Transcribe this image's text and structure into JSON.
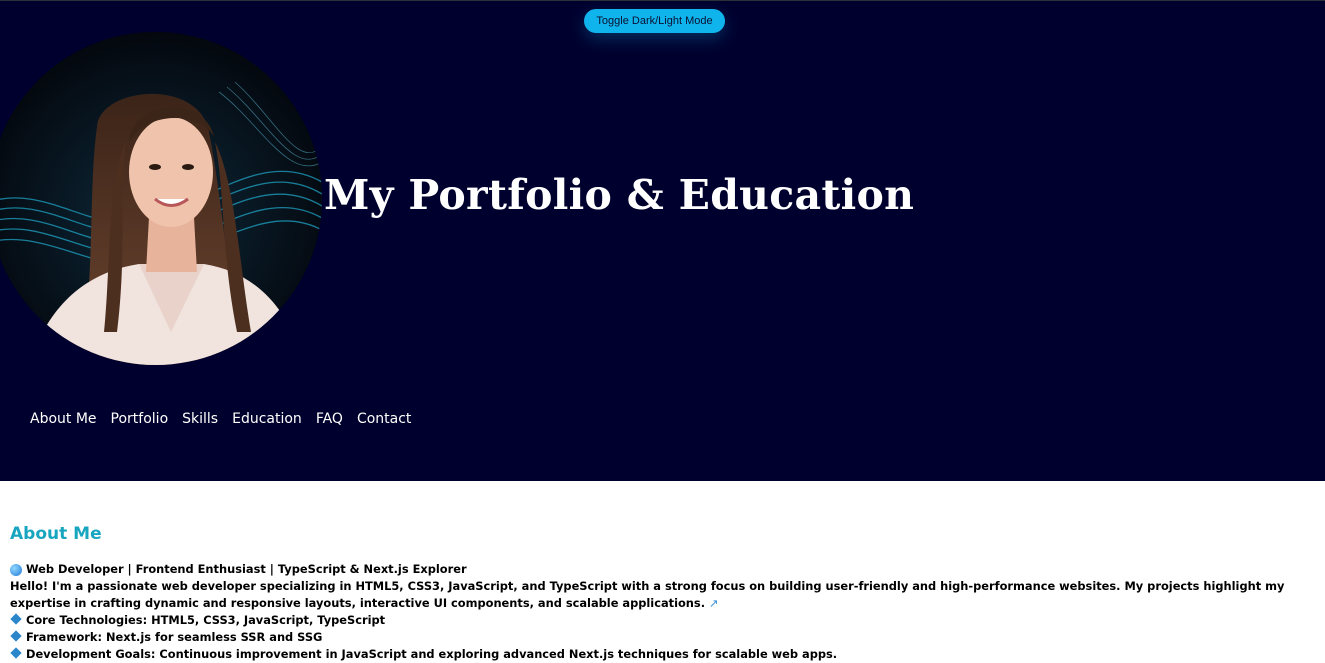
{
  "header": {
    "toggle_label": "Toggle Dark/Light Mode",
    "title": "My Portfolio & Education"
  },
  "nav": {
    "items": [
      {
        "label": "About Me"
      },
      {
        "label": "Portfolio"
      },
      {
        "label": "Skills"
      },
      {
        "label": "Education"
      },
      {
        "label": "FAQ"
      },
      {
        "label": "Contact"
      }
    ]
  },
  "about": {
    "heading": "About Me",
    "tagline": "Web Developer | Frontend Enthusiast | TypeScript & Next.js Explorer",
    "intro": "Hello! I'm a passionate web developer specializing in HTML5, CSS3, JavaScript, and TypeScript with a strong focus on building user-friendly and high-performance websites. My projects highlight my expertise in crafting dynamic and responsive layouts, interactive UI components, and scalable applications.",
    "bullets": [
      "Core Technologies: HTML5, CSS3, JavaScript, TypeScript",
      "Framework: Next.js for seamless SSR and SSG",
      "Development Goals: Continuous improvement in JavaScript and exploring advanced Next.js techniques for scalable web apps."
    ]
  },
  "icons": {
    "globe": "globe-icon",
    "rocket": "rocket-icon",
    "bullet": "blue-diamond-icon"
  },
  "colors": {
    "hero_bg": "#00002e",
    "accent": "#10b4ec",
    "heading": "#17a5bf"
  }
}
